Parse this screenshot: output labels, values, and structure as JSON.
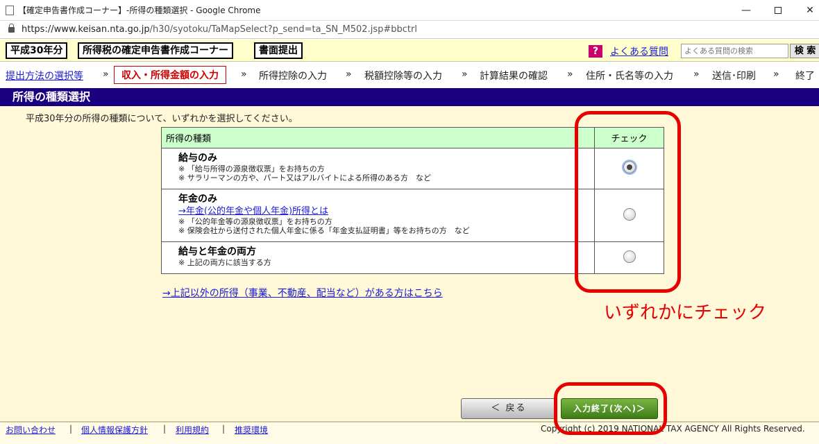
{
  "browser": {
    "title": "【確定申告書作成コーナー】-所得の種類選択 - Google Chrome",
    "url_host": "https://www.keisan.nta.go.jp",
    "url_path": "/h30/syotoku/TaMapSelect?p_send=ta_SN_M502.jsp#bbctrl",
    "minimize": "—",
    "close": "✕"
  },
  "header": {
    "year_tag": "平成30年分",
    "corner_tag": "所得税の確定申告書作成コーナー",
    "submit_tag": "書面提出",
    "help_icon": "?",
    "faq_link": "よくある質問",
    "faq_search_placeholder": "よくある質問の検索",
    "search_button": "検 索"
  },
  "steps": {
    "items": [
      "提出方法の選択等",
      "収入・所得金額の入力",
      "所得控除の入力",
      "税額控除等の入力",
      "計算結果の確認",
      "住所・氏名等の入力",
      "送信･印刷",
      "終了"
    ],
    "separator": "»"
  },
  "section_title": "所得の種類選択",
  "instruction": "平成30年分の所得の種類について、いずれかを選択してください。",
  "table": {
    "col_type": "所得の種類",
    "col_check": "チェック",
    "rows": [
      {
        "title": "給与のみ",
        "notes": [
          "※ 「給与所得の源泉徴収票」をお持ちの方",
          "※ サラリーマンの方や、パート又はアルバイトによる所得のある方　など"
        ],
        "checked": true
      },
      {
        "title": "年金のみ",
        "link": "→年金(公的年金や個人年金)所得とは",
        "notes": [
          "※ 「公的年金等の源泉徴収票」をお持ちの方",
          "※ 保険会社から送付された個人年金に係る「年金支払証明書」等をお持ちの方　など"
        ],
        "checked": false
      },
      {
        "title": "給与と年金の両方",
        "notes": [
          "※ 上記の両方に該当する方"
        ],
        "checked": false
      }
    ]
  },
  "other_income_link": "→上記以外の所得（事業、不動産、配当など）がある方はこちら",
  "annotation_text": "いずれかにチェック",
  "buttons": {
    "back": "＜ 戻る",
    "next": "入力終了(次へ)＞"
  },
  "footer": {
    "links": [
      "お問い合わせ",
      "個人情報保護方針",
      "利用規約",
      "推奨環境"
    ],
    "separator": "|",
    "copyright": "Copyright (c) 2019 NATIONAL TAX AGENCY All Rights Reserved."
  },
  "colors": {
    "section_header_bg": "#1a0080",
    "table_header_bg": "#ccffcc",
    "content_bg": "#fff8d9",
    "annotation_red": "#e60000",
    "next_button_green": "#3e7c17"
  }
}
